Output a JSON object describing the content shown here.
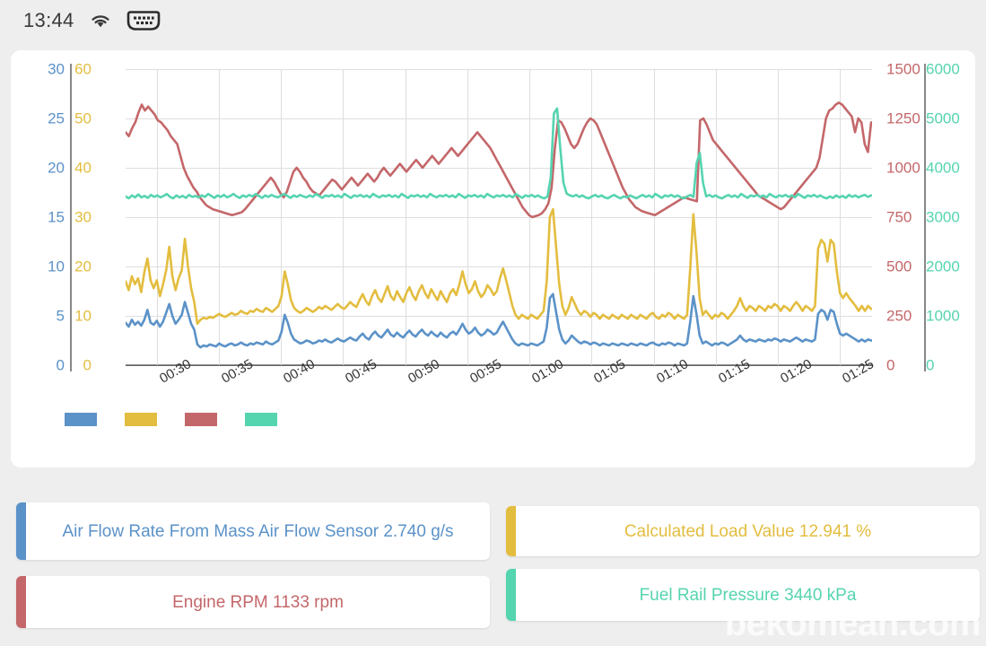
{
  "statusbar": {
    "time": "13:44",
    "wifi_icon": "wifi-icon",
    "obd_icon": "obd-connector-icon"
  },
  "colors": {
    "blue": "#5b92c8",
    "gold": "#e3bd3f",
    "red": "#c4676a",
    "teal": "#55d4b0",
    "grid": "#dedede",
    "axis": "#777777",
    "card_bg": "#ffffff",
    "page_bg": "#eeeeee"
  },
  "chart_data": {
    "type": "line",
    "title": "",
    "xlabel": "",
    "grid": true,
    "legend_position": "bottom-left",
    "legend": [
      {
        "name": "Air Flow Rate From Mass Air Flow Sensor",
        "color": "#5b92c8"
      },
      {
        "name": "Calculated Load Value",
        "color": "#e3bd3f"
      },
      {
        "name": "Engine RPM",
        "color": "#c4676a"
      },
      {
        "name": "Fuel Rail Pressure",
        "color": "#55d4b0"
      }
    ],
    "x_ticks": [
      "00:30",
      "00:35",
      "00:40",
      "00:45",
      "00:50",
      "00:55",
      "01:00",
      "01:05",
      "01:10",
      "01:15",
      "01:20",
      "01:25"
    ],
    "axes": [
      {
        "id": "blue",
        "side": "left",
        "color": "#5b92c8",
        "min": 0,
        "max": 30,
        "step": 5,
        "ticks": [
          "30",
          "25",
          "20",
          "15",
          "10",
          "5",
          "0"
        ],
        "unit": "g/s"
      },
      {
        "id": "gold",
        "side": "left",
        "color": "#e3bd3f",
        "min": 0,
        "max": 60,
        "step": 10,
        "ticks": [
          "60",
          "50",
          "40",
          "30",
          "20",
          "10",
          "0"
        ],
        "unit": "%"
      },
      {
        "id": "red",
        "side": "right",
        "color": "#c4676a",
        "min": 0,
        "max": 1500,
        "step": 250,
        "ticks": [
          "1500",
          "1250",
          "1000",
          "750",
          "500",
          "250",
          "0"
        ],
        "unit": "rpm"
      },
      {
        "id": "teal",
        "side": "right",
        "color": "#55d4b0",
        "min": 0,
        "max": 6000,
        "step": 1000,
        "ticks": [
          "6000",
          "5000",
          "4000",
          "3000",
          "2000",
          "1000",
          "0"
        ],
        "unit": "kPa"
      }
    ],
    "series": [
      {
        "name": "Air Flow Rate From Mass Air Flow Sensor",
        "color": "#5b92c8",
        "axis": "blue",
        "values": [
          4.3,
          3.9,
          4.6,
          4.1,
          4.4,
          4.0,
          4.6,
          5.6,
          4.3,
          4.1,
          4.5,
          3.9,
          4.4,
          5.3,
          6.2,
          5.0,
          4.2,
          4.6,
          5.1,
          6.4,
          5.3,
          4.2,
          3.6,
          2.1,
          1.8,
          2.0,
          1.9,
          2.1,
          2.0,
          1.9,
          2.2,
          2.0,
          1.9,
          2.1,
          2.2,
          2.0,
          2.1,
          2.3,
          2.1,
          2.0,
          2.2,
          2.1,
          2.3,
          2.2,
          2.1,
          2.4,
          2.2,
          2.1,
          2.3,
          2.5,
          3.4,
          5.1,
          4.3,
          3.2,
          2.6,
          2.4,
          2.2,
          2.3,
          2.5,
          2.4,
          2.2,
          2.3,
          2.5,
          2.4,
          2.6,
          2.4,
          2.3,
          2.5,
          2.7,
          2.5,
          2.4,
          2.6,
          2.8,
          2.6,
          2.5,
          2.9,
          3.2,
          2.8,
          2.6,
          3.1,
          3.4,
          3.0,
          2.8,
          3.2,
          3.6,
          3.1,
          2.9,
          3.3,
          3.0,
          2.8,
          3.2,
          3.5,
          3.1,
          2.9,
          3.3,
          3.6,
          3.2,
          3.0,
          3.4,
          3.1,
          2.9,
          3.3,
          3.0,
          2.8,
          3.2,
          3.4,
          3.1,
          3.6,
          4.2,
          3.6,
          3.2,
          3.4,
          3.8,
          3.3,
          3.0,
          3.2,
          3.6,
          3.4,
          3.1,
          3.3,
          3.9,
          4.4,
          3.8,
          3.2,
          2.6,
          2.2,
          2.0,
          2.2,
          2.1,
          2.0,
          2.2,
          2.1,
          2.0,
          2.2,
          2.4,
          3.8,
          6.8,
          7.2,
          5.4,
          3.6,
          2.6,
          2.2,
          2.5,
          3.0,
          2.7,
          2.4,
          2.2,
          2.4,
          2.3,
          2.1,
          2.3,
          2.2,
          2.0,
          2.2,
          2.1,
          2.0,
          2.2,
          2.1,
          2.0,
          2.2,
          2.1,
          2.0,
          2.2,
          2.1,
          2.0,
          2.2,
          2.1,
          2.0,
          2.2,
          2.3,
          2.1,
          2.0,
          2.2,
          2.1,
          2.3,
          2.2,
          2.0,
          2.2,
          2.1,
          2.0,
          2.2,
          4.4,
          7.0,
          5.2,
          3.0,
          2.2,
          2.4,
          2.2,
          2.0,
          2.2,
          2.1,
          2.3,
          2.2,
          2.0,
          2.2,
          2.4,
          2.6,
          3.0,
          2.6,
          2.4,
          2.6,
          2.5,
          2.4,
          2.6,
          2.5,
          2.4,
          2.6,
          2.5,
          2.7,
          2.6,
          2.4,
          2.6,
          2.5,
          2.4,
          2.6,
          2.8,
          2.6,
          2.4,
          2.6,
          2.5,
          2.4,
          2.6,
          5.2,
          5.6,
          5.4,
          4.6,
          5.6,
          5.4,
          4.2,
          3.2,
          3.0,
          3.2,
          3.0,
          2.8,
          2.6,
          2.4,
          2.6,
          2.4,
          2.6,
          2.5
        ]
      },
      {
        "name": "Calculated Load Value",
        "color": "#e3bd3f",
        "axis": "gold",
        "values": [
          17.0,
          15.2,
          18.0,
          16.4,
          17.6,
          14.8,
          18.8,
          21.6,
          17.2,
          15.6,
          17.2,
          14.0,
          16.4,
          19.2,
          24.0,
          18.0,
          15.2,
          17.6,
          19.2,
          25.6,
          20.0,
          15.6,
          12.8,
          8.4,
          9.2,
          9.6,
          9.4,
          9.8,
          9.6,
          10.0,
          10.4,
          10.0,
          9.8,
          10.2,
          10.6,
          10.2,
          10.4,
          11.0,
          10.6,
          10.4,
          11.0,
          10.8,
          11.4,
          11.0,
          10.8,
          11.6,
          11.2,
          10.8,
          11.4,
          12.0,
          14.0,
          19.0,
          16.4,
          13.2,
          11.6,
          11.0,
          10.6,
          11.0,
          11.6,
          11.2,
          10.8,
          11.2,
          11.8,
          11.4,
          12.0,
          11.6,
          11.2,
          11.8,
          12.4,
          11.8,
          11.4,
          12.0,
          12.8,
          12.2,
          11.8,
          13.2,
          14.4,
          13.0,
          12.2,
          14.0,
          15.2,
          13.6,
          12.8,
          14.4,
          16.0,
          14.0,
          13.2,
          15.0,
          13.8,
          12.8,
          14.6,
          15.8,
          14.2,
          13.2,
          15.0,
          16.2,
          14.6,
          13.6,
          15.4,
          14.2,
          13.2,
          15.0,
          13.8,
          12.8,
          14.6,
          15.4,
          14.2,
          16.4,
          19.0,
          16.4,
          14.6,
          15.4,
          17.0,
          15.0,
          13.8,
          14.6,
          16.2,
          15.4,
          14.2,
          15.0,
          17.6,
          19.6,
          17.2,
          14.6,
          12.0,
          10.2,
          9.4,
          10.2,
          9.8,
          9.4,
          10.2,
          9.8,
          9.4,
          10.2,
          11.0,
          17.0,
          30.0,
          31.6,
          24.0,
          16.4,
          12.0,
          10.2,
          11.6,
          13.8,
          12.4,
          11.0,
          10.2,
          11.0,
          10.6,
          9.8,
          10.6,
          10.2,
          9.4,
          10.2,
          9.8,
          9.4,
          10.2,
          9.8,
          9.4,
          10.2,
          9.8,
          9.4,
          10.2,
          9.8,
          9.4,
          10.2,
          9.8,
          9.4,
          10.2,
          10.6,
          9.8,
          9.4,
          10.2,
          9.8,
          10.6,
          10.2,
          9.4,
          10.2,
          9.8,
          9.4,
          10.2,
          19.6,
          30.6,
          23.0,
          13.6,
          10.2,
          11.0,
          10.2,
          9.4,
          10.2,
          9.8,
          10.6,
          10.2,
          9.4,
          10.2,
          11.0,
          12.0,
          13.6,
          12.0,
          11.0,
          12.0,
          11.6,
          11.0,
          12.0,
          11.6,
          11.0,
          12.0,
          11.6,
          12.4,
          12.0,
          11.0,
          12.0,
          11.6,
          11.0,
          12.0,
          12.8,
          12.0,
          11.0,
          12.0,
          11.6,
          11.0,
          12.0,
          23.6,
          25.4,
          24.6,
          21.0,
          25.4,
          24.6,
          19.0,
          14.6,
          13.6,
          14.6,
          13.6,
          12.8,
          12.0,
          11.0,
          12.0,
          11.0,
          12.0,
          11.4
        ]
      },
      {
        "name": "Engine RPM",
        "color": "#c4676a",
        "axis": "red",
        "values": [
          1180,
          1160,
          1200,
          1230,
          1280,
          1320,
          1290,
          1310,
          1290,
          1270,
          1240,
          1230,
          1210,
          1190,
          1160,
          1140,
          1120,
          1060,
          1000,
          960,
          930,
          900,
          880,
          850,
          830,
          810,
          800,
          790,
          785,
          780,
          775,
          770,
          765,
          760,
          765,
          770,
          775,
          790,
          810,
          830,
          850,
          870,
          890,
          910,
          930,
          950,
          930,
          900,
          870,
          850,
          880,
          930,
          980,
          1000,
          980,
          950,
          930,
          900,
          880,
          870,
          860,
          880,
          900,
          920,
          940,
          930,
          910,
          890,
          910,
          930,
          950,
          930,
          910,
          930,
          950,
          970,
          950,
          930,
          950,
          980,
          1000,
          980,
          960,
          980,
          1000,
          1020,
          1000,
          980,
          1000,
          1020,
          1040,
          1020,
          1000,
          1020,
          1040,
          1060,
          1040,
          1020,
          1040,
          1060,
          1080,
          1100,
          1080,
          1060,
          1080,
          1100,
          1120,
          1140,
          1160,
          1180,
          1160,
          1140,
          1120,
          1100,
          1070,
          1040,
          1010,
          980,
          950,
          920,
          890,
          860,
          830,
          800,
          780,
          760,
          750,
          755,
          760,
          770,
          790,
          820,
          900,
          1100,
          1240,
          1230,
          1200,
          1160,
          1120,
          1100,
          1120,
          1160,
          1200,
          1230,
          1250,
          1240,
          1220,
          1180,
          1140,
          1100,
          1060,
          1020,
          980,
          940,
          900,
          870,
          840,
          820,
          800,
          790,
          780,
          775,
          770,
          765,
          760,
          770,
          780,
          790,
          800,
          810,
          820,
          830,
          840,
          850,
          845,
          840,
          835,
          830,
          1240,
          1250,
          1220,
          1180,
          1140,
          1120,
          1100,
          1080,
          1060,
          1040,
          1020,
          1000,
          980,
          960,
          940,
          920,
          900,
          880,
          860,
          850,
          840,
          830,
          820,
          810,
          800,
          790,
          800,
          820,
          840,
          860,
          880,
          900,
          920,
          940,
          960,
          980,
          1000,
          1050,
          1150,
          1250,
          1290,
          1300,
          1320,
          1330,
          1320,
          1300,
          1280,
          1260,
          1180,
          1250,
          1230,
          1120,
          1080,
          1230
        ]
      },
      {
        "name": "Fuel Rail Pressure",
        "color": "#55d4b0",
        "axis": "teal",
        "values": [
          3420,
          3380,
          3440,
          3400,
          3460,
          3400,
          3430,
          3390,
          3450,
          3410,
          3440,
          3400,
          3430,
          3470,
          3410,
          3380,
          3440,
          3400,
          3430,
          3390,
          3450,
          3410,
          3430,
          3400,
          3440,
          3410,
          3470,
          3430,
          3390,
          3440,
          3410,
          3450,
          3400,
          3430,
          3470,
          3420,
          3390,
          3440,
          3410,
          3450,
          3420,
          3470,
          3430,
          3390,
          3440,
          3410,
          3450,
          3420,
          3400,
          3440,
          3470,
          3430,
          3390,
          3440,
          3410,
          3450,
          3420,
          3400,
          3440,
          3410,
          3470,
          3430,
          3390,
          3440,
          3420,
          3450,
          3410,
          3440,
          3400,
          3470,
          3430,
          3390,
          3440,
          3420,
          3450,
          3410,
          3440,
          3400,
          3470,
          3430,
          3400,
          3440,
          3420,
          3450,
          3410,
          3440,
          3400,
          3470,
          3430,
          3390,
          3440,
          3420,
          3450,
          3410,
          3440,
          3400,
          3470,
          3430,
          3400,
          3440,
          3420,
          3450,
          3410,
          3440,
          3400,
          3470,
          3430,
          3390,
          3440,
          3420,
          3450,
          3410,
          3440,
          3400,
          3470,
          3430,
          3400,
          3440,
          3420,
          3450,
          3410,
          3440,
          3400,
          3470,
          3430,
          3390,
          3440,
          3420,
          3450,
          3410,
          3440,
          3400,
          3380,
          3420,
          3800,
          5100,
          5200,
          4400,
          3700,
          3480,
          3440,
          3420,
          3450,
          3410,
          3440,
          3400,
          3380,
          3420,
          3450,
          3410,
          3440,
          3400,
          3380,
          3420,
          3450,
          3410,
          3380,
          3420,
          3400,
          3440,
          3410,
          3380,
          3420,
          3450,
          3410,
          3440,
          3400,
          3470,
          3430,
          3390,
          3440,
          3420,
          3450,
          3410,
          3440,
          3400,
          3380,
          3420,
          3450,
          3410,
          4100,
          4300,
          3700,
          3420,
          3450,
          3410,
          3440,
          3400,
          3380,
          3420,
          3450,
          3410,
          3440,
          3400,
          3470,
          3430,
          3390,
          3440,
          3420,
          3450,
          3410,
          3440,
          3400,
          3470,
          3430,
          3400,
          3440,
          3420,
          3450,
          3410,
          3440,
          3400,
          3470,
          3430,
          3390,
          3440,
          3420,
          3450,
          3410,
          3440,
          3400,
          3380,
          3420,
          3390,
          3440,
          3400,
          3430,
          3390,
          3450,
          3410,
          3440,
          3400,
          3430,
          3450,
          3410,
          3440
        ]
      }
    ]
  },
  "cards": [
    {
      "id": "air-flow-rate",
      "label": "Air Flow Rate From Mass Air Flow Sensor 2.740 g/s",
      "color": "#5b92c8"
    },
    {
      "id": "engine-rpm",
      "label": "Engine RPM 1133 rpm",
      "color": "#c4676a"
    },
    {
      "id": "calculated-load",
      "label": "Calculated Load Value 12.941 %",
      "color": "#e3bd3f"
    },
    {
      "id": "fuel-rail-pressure",
      "label": "Fuel Rail Pressure 3440 kPa",
      "color": "#55d4b0"
    }
  ],
  "watermark": "bekomean.com"
}
